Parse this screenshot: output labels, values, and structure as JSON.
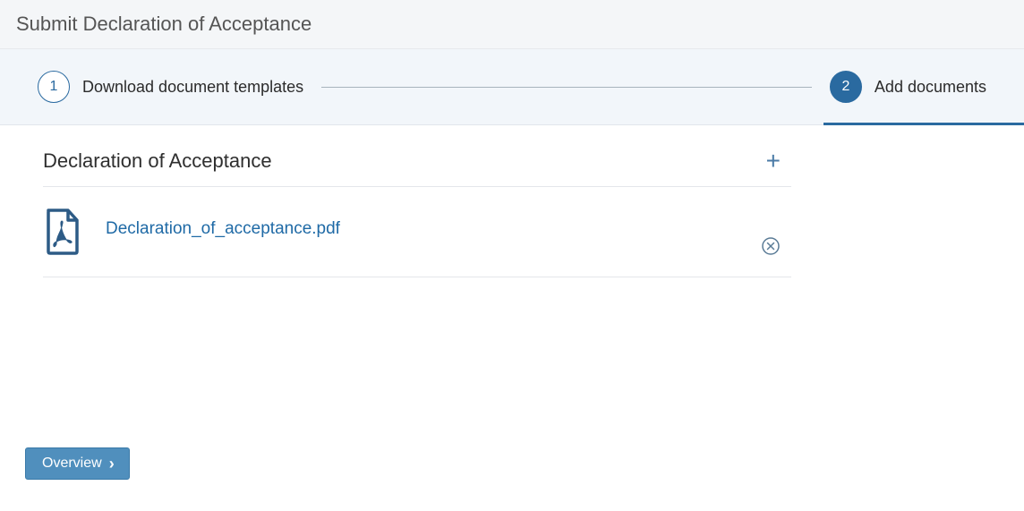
{
  "header": {
    "title": "Submit Declaration of Acceptance"
  },
  "wizard": {
    "step1": {
      "number": "1",
      "label": "Download document templates"
    },
    "step2": {
      "number": "2",
      "label": "Add documents"
    }
  },
  "section": {
    "title": "Declaration of Acceptance",
    "add_label": "+"
  },
  "file": {
    "name": "Declaration_of_acceptance.pdf"
  },
  "footer": {
    "overview_label": "Overview"
  }
}
